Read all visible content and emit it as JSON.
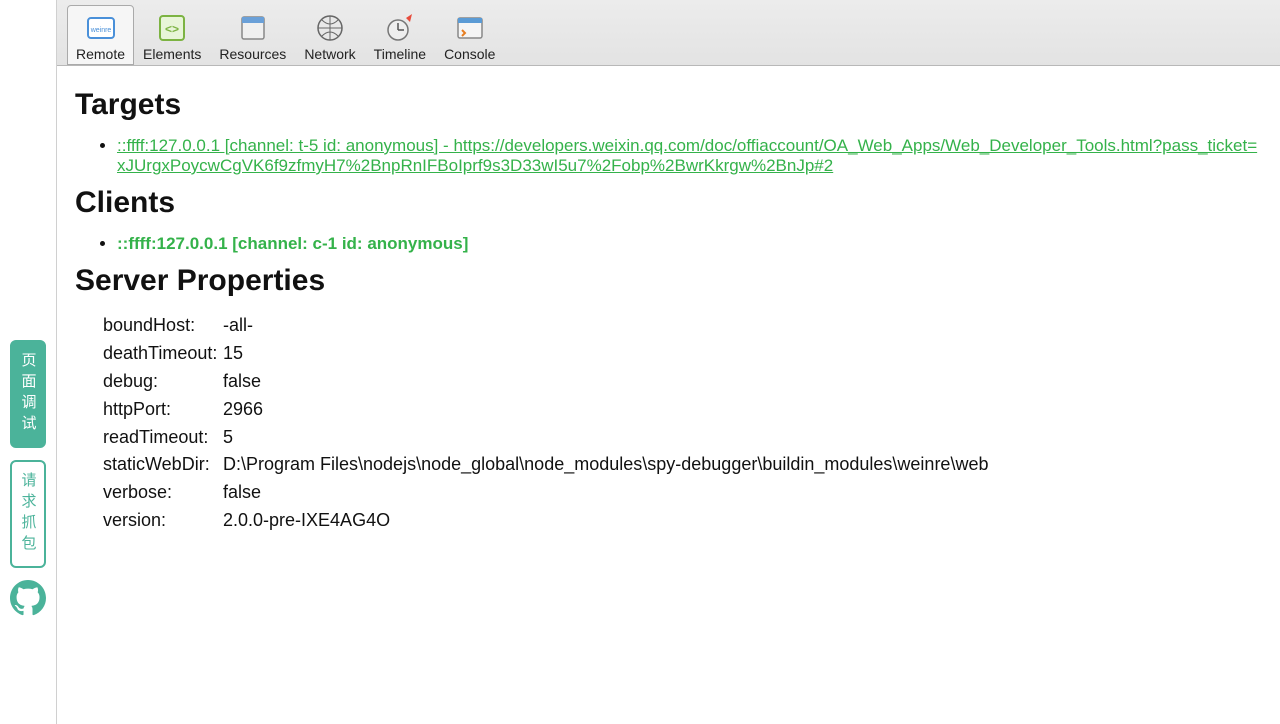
{
  "sidebar": {
    "pageDebug": "页面调试",
    "requestCapture": "请求抓包"
  },
  "toolbar": {
    "tabs": [
      {
        "label": "Remote"
      },
      {
        "label": "Elements"
      },
      {
        "label": "Resources"
      },
      {
        "label": "Network"
      },
      {
        "label": "Timeline"
      },
      {
        "label": "Console"
      }
    ]
  },
  "sections": {
    "targets": "Targets",
    "clients": "Clients",
    "serverProps": "Server Properties"
  },
  "targets": [
    "::ffff:127.0.0.1 [channel: t-5 id: anonymous] - https://developers.weixin.qq.com/doc/offiaccount/OA_Web_Apps/Web_Developer_Tools.html?pass_ticket=xJUrgxPoycwCgVK6f9zfmyH7%2BnpRnIFBoIprf9s3D33wI5u7%2Fobp%2BwrKkrgw%2BnJp#2"
  ],
  "clients": [
    "::ffff:127.0.0.1 [channel: c-1 id: anonymous]"
  ],
  "serverProps": [
    {
      "key": "boundHost:",
      "val": "-all-"
    },
    {
      "key": "deathTimeout:",
      "val": "15"
    },
    {
      "key": "debug:",
      "val": "false"
    },
    {
      "key": "httpPort:",
      "val": "2966"
    },
    {
      "key": "readTimeout:",
      "val": "5"
    },
    {
      "key": "staticWebDir:",
      "val": "D:\\Program Files\\nodejs\\node_global\\node_modules\\spy-debugger\\buildin_modules\\weinre\\web"
    },
    {
      "key": "verbose:",
      "val": "false"
    },
    {
      "key": "version:",
      "val": "2.0.0-pre-IXE4AG4O"
    }
  ]
}
